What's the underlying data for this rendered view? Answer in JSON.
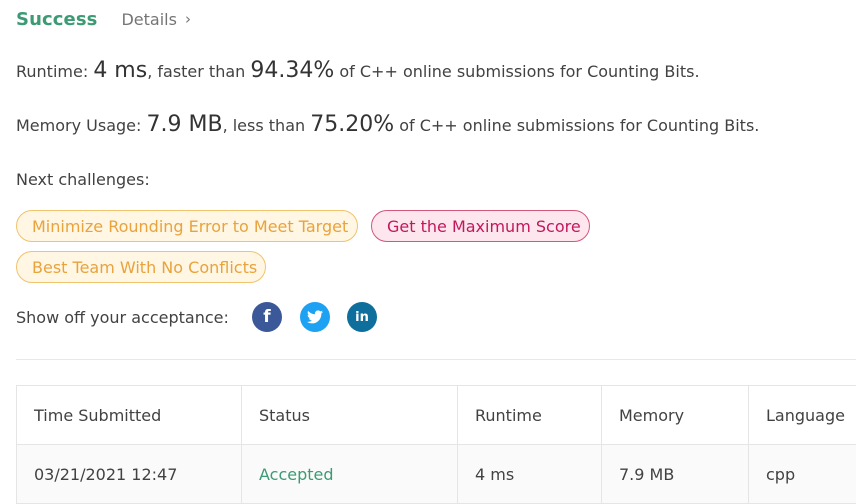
{
  "header": {
    "status": "Success",
    "details_label": "Details",
    "details_chevron": "›"
  },
  "runtime": {
    "label": "Runtime:",
    "value": "4 ms",
    "comparison": ", faster than",
    "percent": "94.34%",
    "suffix": "of C++ online submissions for Counting Bits."
  },
  "memory": {
    "label": "Memory Usage:",
    "value": "7.9 MB",
    "comparison": ", less than",
    "percent": "75.20%",
    "suffix": "of C++ online submissions for Counting Bits."
  },
  "next_challenges": {
    "label": "Next challenges:",
    "items": [
      {
        "title": "Minimize Rounding Error to Meet Target",
        "difficulty": "medium"
      },
      {
        "title": "Get the Maximum Score",
        "difficulty": "hard"
      },
      {
        "title": "Best Team With No Conflicts",
        "difficulty": "medium"
      }
    ]
  },
  "share": {
    "label": "Show off your acceptance:",
    "icons": [
      "facebook-icon",
      "twitter-icon",
      "linkedin-icon"
    ],
    "facebook_glyph": "f",
    "linkedin_glyph": "in"
  },
  "colors": {
    "accent_green": "#3c9a74",
    "medium": "#e8a33d",
    "hard": "#c2185b"
  },
  "submissions": {
    "columns": [
      "Time Submitted",
      "Status",
      "Runtime",
      "Memory",
      "Language"
    ],
    "rows": [
      [
        "03/21/2021 12:47",
        "Accepted",
        "4 ms",
        "7.9 MB",
        "cpp"
      ]
    ]
  }
}
